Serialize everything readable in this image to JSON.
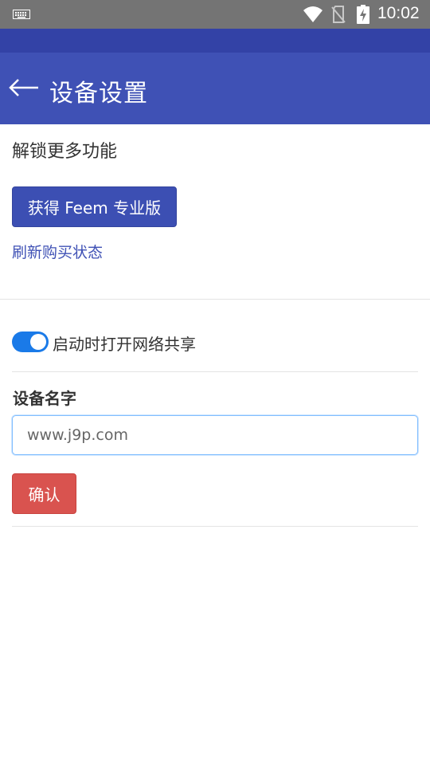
{
  "status_bar": {
    "time": "10:02",
    "icons": [
      "keyboard-icon",
      "wifi-icon",
      "no-sim-icon",
      "battery-charging-icon"
    ]
  },
  "app_bar": {
    "back_icon": "arrow-left-icon",
    "title": "设备设置"
  },
  "unlock": {
    "heading": "解锁更多功能",
    "pro_button_label": "获得 Feem 专业版",
    "refresh_link_label": "刷新购买状态"
  },
  "settings": {
    "network_share_toggle": {
      "label": "启动时打开网络共享",
      "checked": true
    },
    "device_name": {
      "label": "设备名字",
      "value": "www.j9p.com"
    },
    "confirm_label": "确认"
  },
  "colors": {
    "status_bar": "#747474",
    "app_bar": "#3f51b5",
    "primary_button": "#3c4fb3",
    "toggle_on": "#1a7ae8",
    "confirm_button": "#d9534f"
  }
}
